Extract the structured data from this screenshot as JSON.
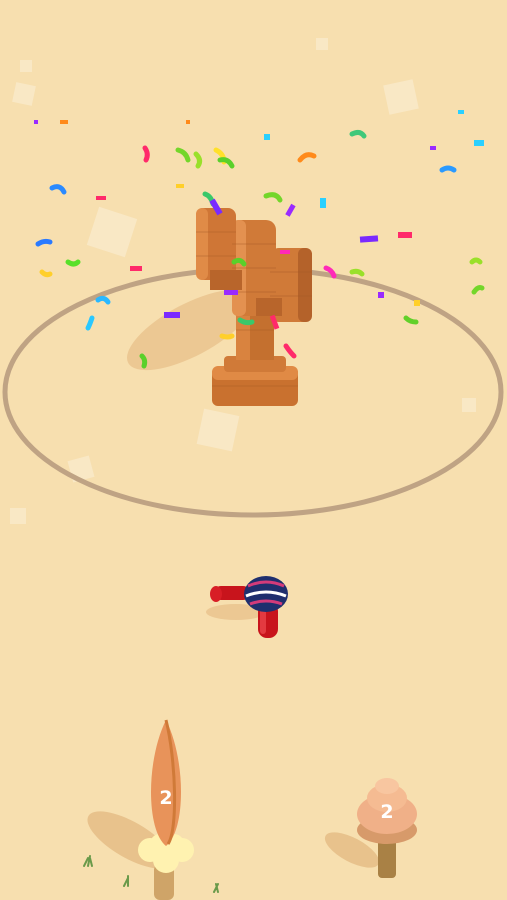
{
  "game": {
    "scene": "voxel-cactus-arena-celebration",
    "colors": {
      "sand": "#f7dfaf",
      "arena_ring": "#bfa384",
      "cactus": "#d07a38",
      "cactus_shadow": "#a65a26",
      "player_body": "#c8141c",
      "player_cap": "#1f2f6e",
      "bush_flower": "#fff2b0"
    },
    "collectibles": [
      {
        "kind": "tall-cactus",
        "level": "2"
      },
      {
        "kind": "mushroom-tree",
        "level": "2"
      }
    ],
    "effects": [
      "confetti-burst"
    ]
  }
}
